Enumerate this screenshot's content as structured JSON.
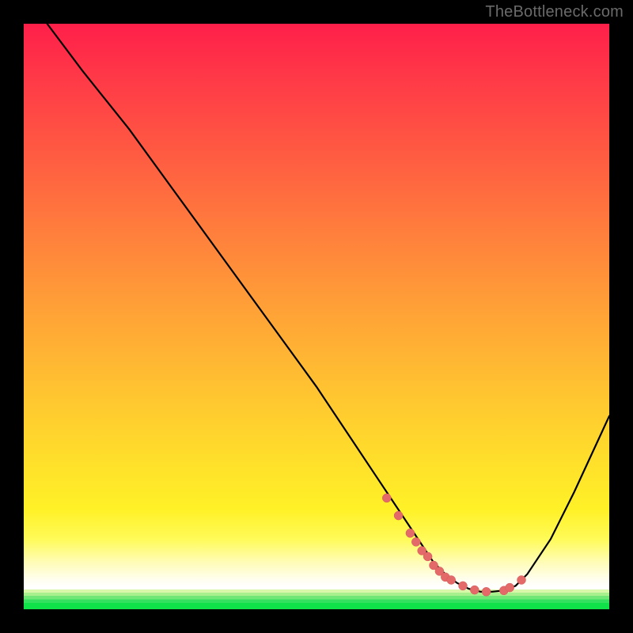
{
  "watermark": "TheBottleneck.com",
  "chart_data": {
    "type": "line",
    "title": "",
    "xlabel": "",
    "ylabel": "",
    "xlim": [
      0,
      100
    ],
    "ylim": [
      0,
      100
    ],
    "series": [
      {
        "name": "curve",
        "x": [
          4,
          10,
          18,
          26,
          34,
          42,
          50,
          56,
          60,
          64,
          66,
          68,
          70,
          72,
          74,
          76,
          78,
          80,
          82,
          84,
          86,
          90,
          94,
          100
        ],
        "y": [
          100,
          92,
          82,
          71,
          60,
          49,
          38,
          29,
          23,
          17,
          14,
          11,
          8,
          6,
          4.5,
          3.5,
          3,
          3,
          3.2,
          4,
          6,
          12,
          20,
          33
        ]
      }
    ],
    "marker_points": {
      "name": "highlight-dots",
      "x": [
        62,
        64,
        66,
        67,
        68,
        69,
        70,
        71,
        72,
        73,
        75,
        77,
        79,
        82,
        83,
        85
      ],
      "y": [
        19,
        16,
        13,
        11.5,
        10,
        9,
        7.5,
        6.5,
        5.5,
        5,
        4,
        3.3,
        3,
        3.2,
        3.7,
        5
      ]
    },
    "background_gradient": {
      "top_color": "#ff1f4a",
      "mid_color": "#ffd52e",
      "bottom_color": "#10e24a"
    }
  }
}
